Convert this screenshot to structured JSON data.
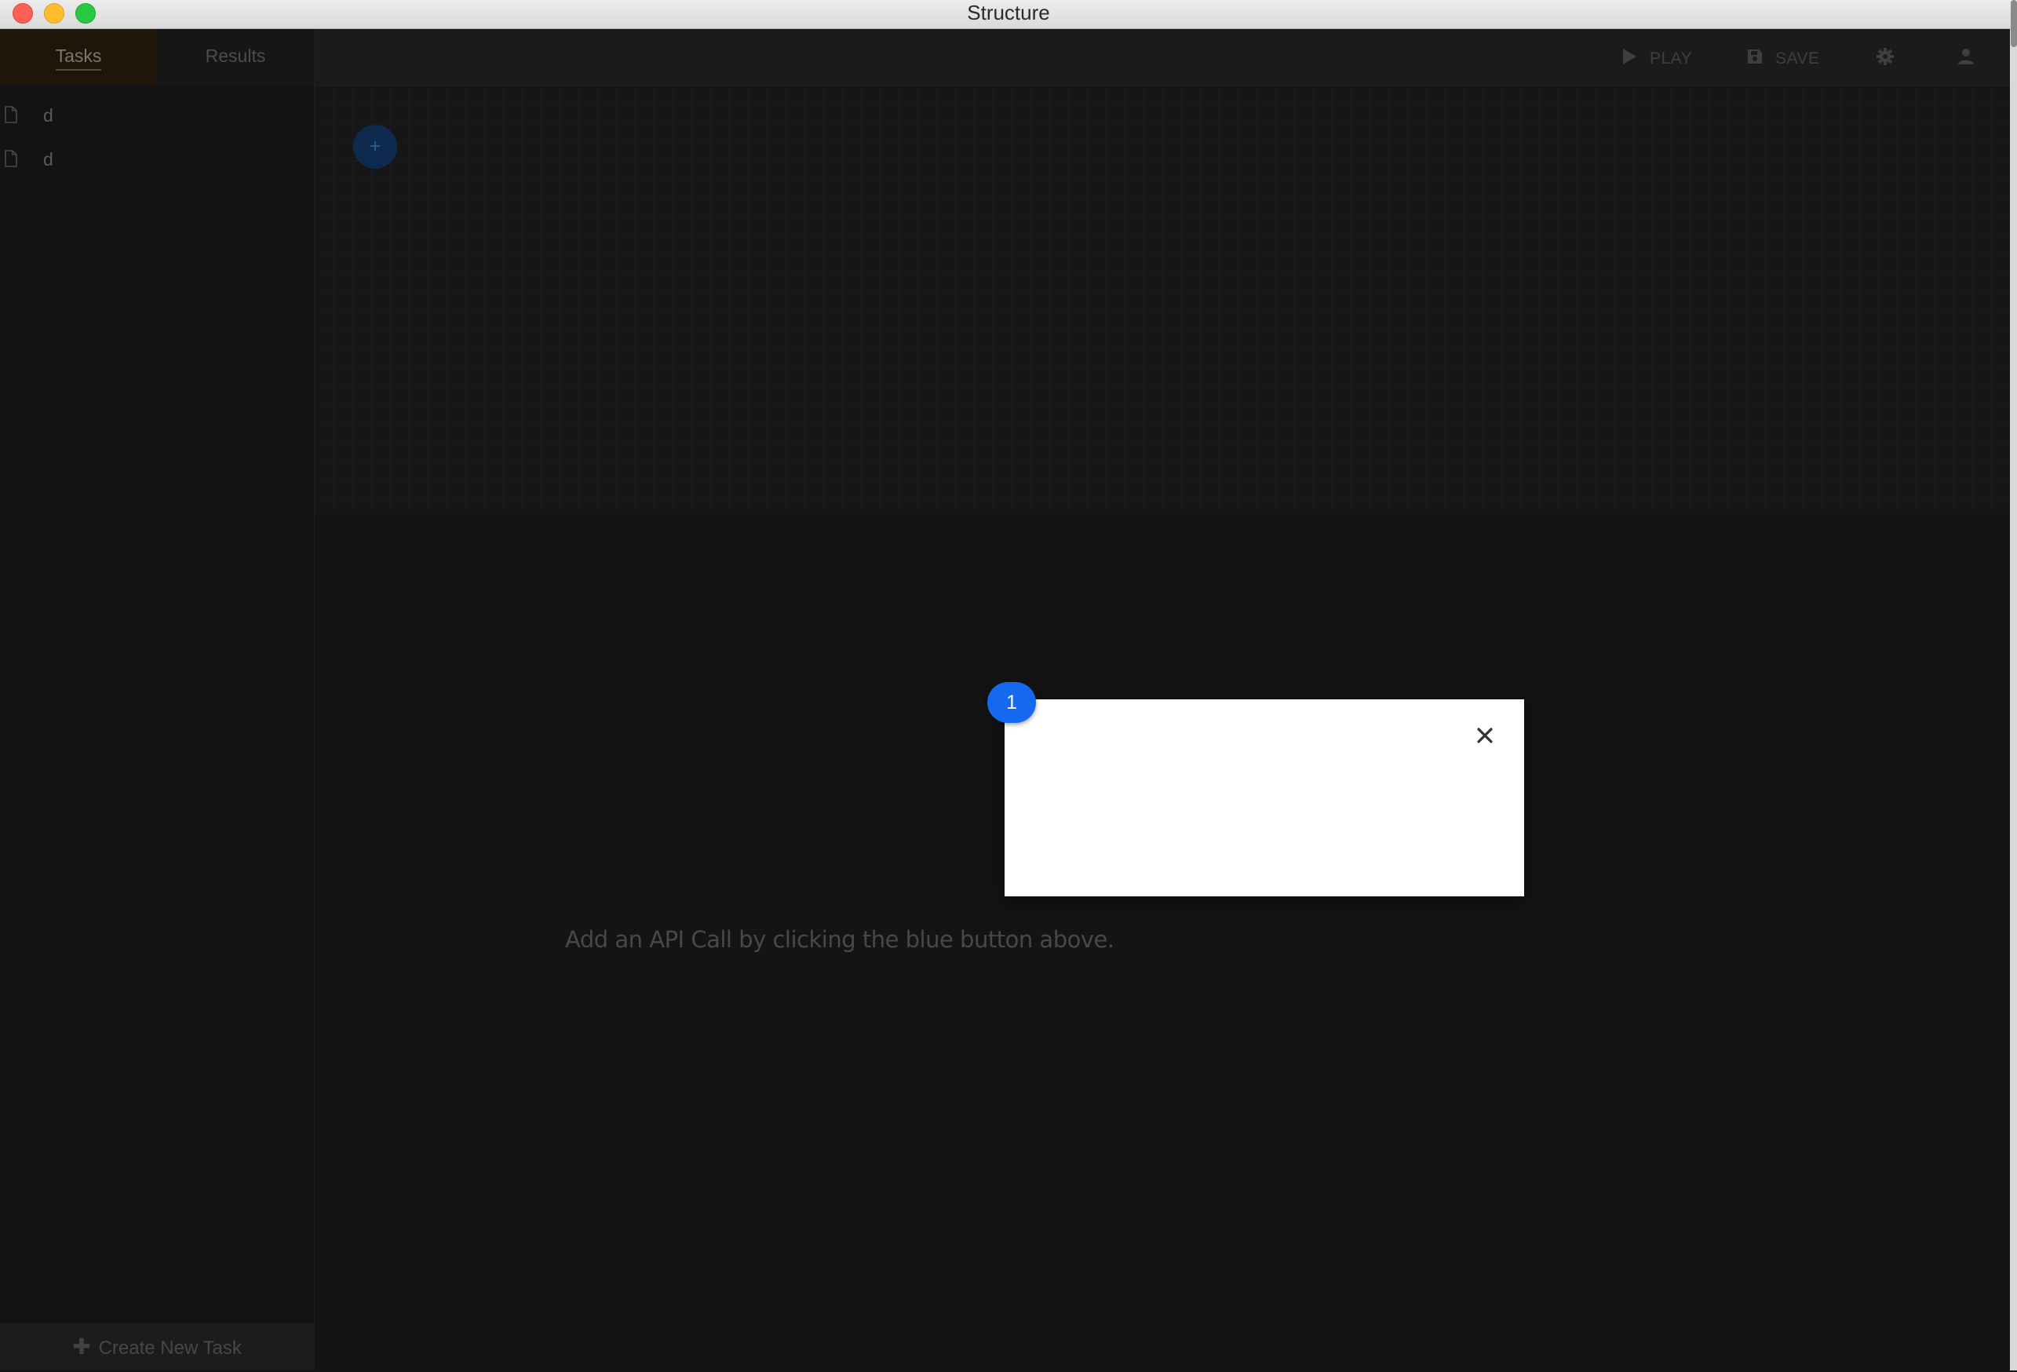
{
  "window": {
    "title": "Structure"
  },
  "sidebar": {
    "tabs": [
      {
        "label": "Tasks",
        "active": true
      },
      {
        "label": "Results",
        "active": false
      }
    ],
    "tasks": [
      {
        "label": "d",
        "icon": "file-icon"
      },
      {
        "label": "d",
        "icon": "file-icon"
      }
    ],
    "create_label": "Create New Task"
  },
  "toolbar": {
    "play_label": "PLAY",
    "save_label": "SAVE"
  },
  "canvas": {
    "add_button_symbol": "+",
    "hint": "Add an API Call by clicking the blue button above."
  },
  "tour": {
    "step": "1",
    "close_symbol": "✕"
  },
  "colors": {
    "accent_blue": "#1469f0",
    "background": "#141414",
    "popover": "#ffffff"
  }
}
